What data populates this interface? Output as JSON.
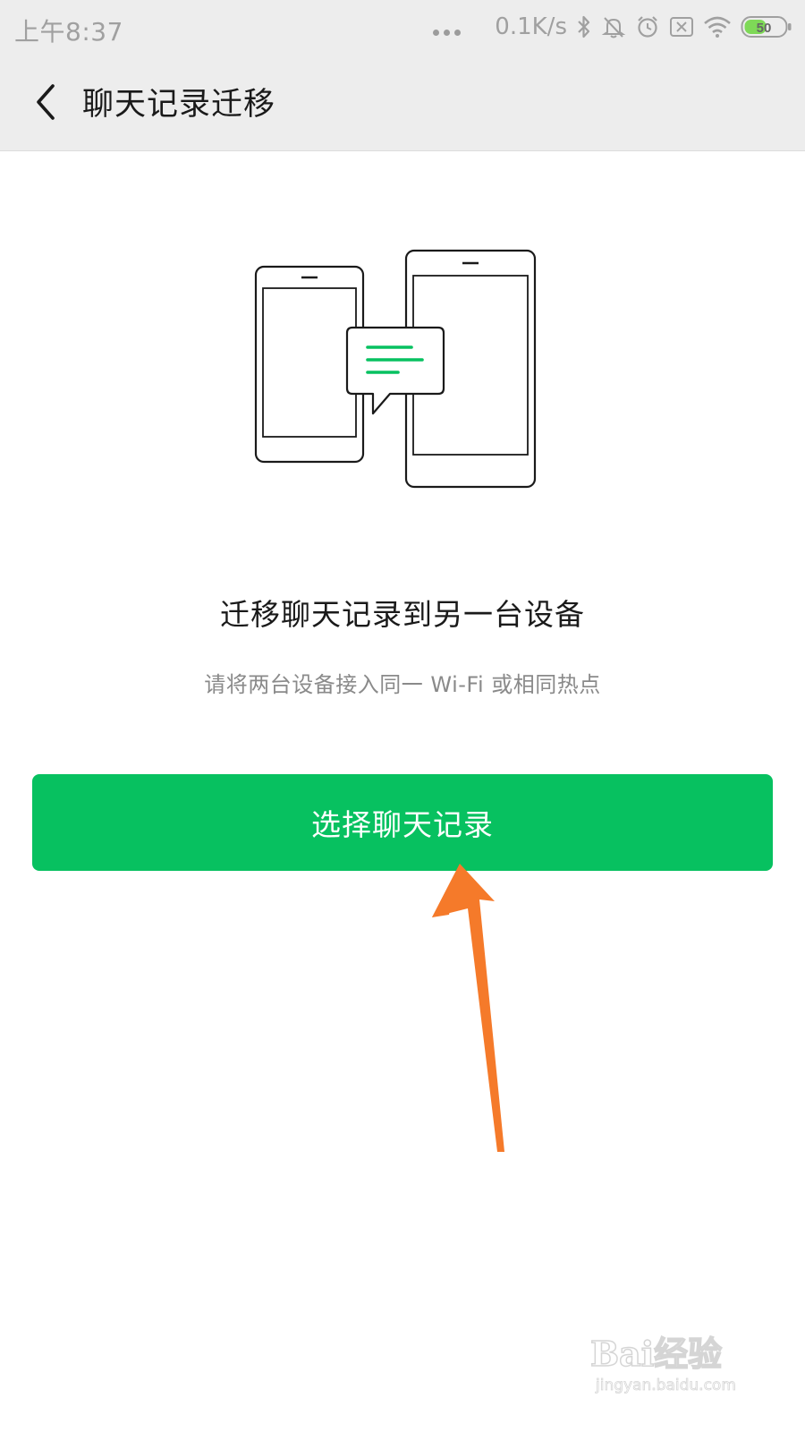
{
  "status_bar": {
    "time": "上午8:37",
    "network_speed": "0.1K/s",
    "battery_level": "50",
    "icons": [
      "more-dots-icon",
      "bluetooth-icon",
      "mute-bell-icon",
      "alarm-icon",
      "sim-off-icon",
      "wifi-icon",
      "battery-icon"
    ]
  },
  "app_bar": {
    "back_icon": "chevron-left-icon",
    "title": "聊天记录迁移"
  },
  "main": {
    "illustration": "two-phones-chat-transfer-illustration",
    "headline": "迁移聊天记录到另一台设备",
    "subline": "请将两台设备接入同一 Wi-Fi 或相同热点",
    "primary_button_label": "选择聊天记录"
  },
  "annotation": {
    "arrow_color": "#f57a2a",
    "arrow_icon": "orange-arrow-pointer"
  },
  "watermark": {
    "logo_text": "Bai经验",
    "url": "jingyan.baidu.com"
  },
  "colors": {
    "accent_green": "#07c160",
    "bar_gray": "#ededed"
  }
}
